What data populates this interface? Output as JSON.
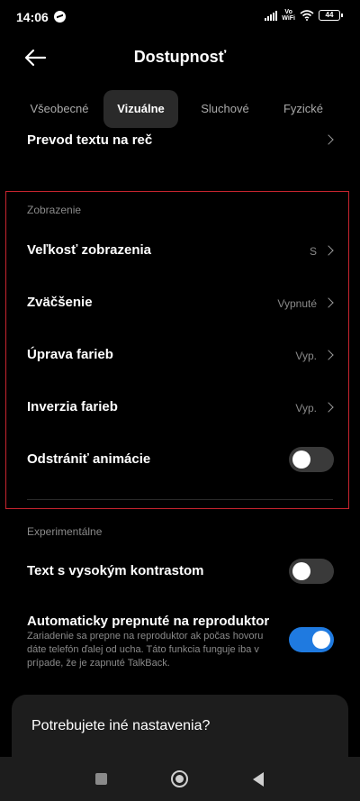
{
  "status_bar": {
    "time": "14:06",
    "vowifi_line1": "Vo",
    "vowifi_line2": "WiFi",
    "battery": "44"
  },
  "header": {
    "title": "Dostupnosť"
  },
  "tabs": [
    {
      "label": "Všeobecné",
      "active": false
    },
    {
      "label": "Vizuálne",
      "active": true
    },
    {
      "label": "Sluchové",
      "active": false
    },
    {
      "label": "Fyzické",
      "active": false
    }
  ],
  "partial_row": {
    "label": "Prevod textu na reč"
  },
  "display_section": {
    "title": "Zobrazenie",
    "items": [
      {
        "label": "Veľkosť zobrazenia",
        "value": "S"
      },
      {
        "label": "Zväčšenie",
        "value": "Vypnuté"
      },
      {
        "label": "Úprava farieb",
        "value": "Vyp."
      },
      {
        "label": "Inverzia farieb",
        "value": "Vyp."
      },
      {
        "label": "Odstrániť animácie",
        "toggle": false
      }
    ]
  },
  "experimental_section": {
    "title": "Experimentálne",
    "high_contrast": {
      "label": "Text s vysokým kontrastom",
      "toggle": false
    },
    "auto_speaker": {
      "label": "Automaticky prepnuté na reproduktor",
      "description": "Zariadenie sa prepne na reproduktor ak počas hovoru dáte telefón ďalej od ucha. Táto funkcia funguje iba v prípade, že je zapnuté TalkBack.",
      "toggle": true
    }
  },
  "more_settings": {
    "label": "Potrebujete iné nastavenia?"
  },
  "colors": {
    "accent": "#1f7ae0",
    "highlight_border": "#c6242e",
    "background": "#000000"
  },
  "icons": [
    "messenger-icon",
    "signal-icon",
    "wifi-icon",
    "battery-icon",
    "back-arrow-icon",
    "chevron-right-icon",
    "nav-recents-icon",
    "nav-home-icon",
    "nav-back-icon"
  ]
}
